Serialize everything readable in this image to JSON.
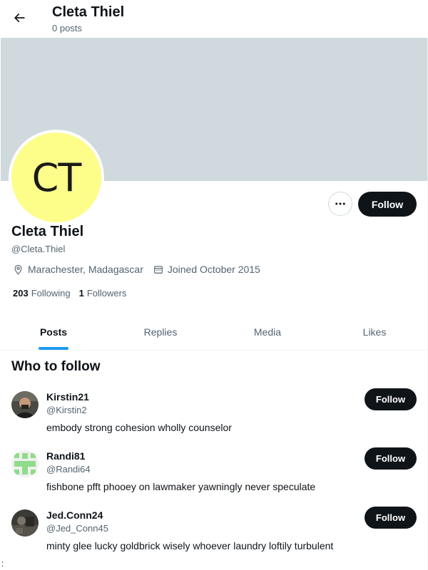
{
  "header": {
    "title": "Cleta Thiel",
    "subtitle": "0 posts",
    "back_icon": "arrow-left-icon"
  },
  "profile": {
    "avatar_initials": "CT",
    "avatar_color": "#fdfd8a",
    "banner_color": "#cfd9de",
    "more_icon": "more-horizontal-icon",
    "follow_label": "Follow",
    "display_name": "Cleta Thiel",
    "handle": "@Cleta.Thiel",
    "location": "Marachester, Madagascar",
    "joined": "Joined October 2015",
    "following_count": "203",
    "following_label": "Following",
    "followers_count": "1",
    "followers_label": "Followers"
  },
  "tabs": [
    {
      "label": "Posts",
      "active": true
    },
    {
      "label": "Replies",
      "active": false
    },
    {
      "label": "Media",
      "active": false
    },
    {
      "label": "Likes",
      "active": false
    }
  ],
  "who_to_follow": {
    "title": "Who to follow",
    "suggestions": [
      {
        "name": "Kirstin21",
        "handle": "@Kirstin2",
        "bio": "embody strong cohesion wholly counselor",
        "follow_label": "Follow"
      },
      {
        "name": "Randi81",
        "handle": "@Randi64",
        "bio": "fishbone pfft phooey on lawmaker yawningly never speculate",
        "follow_label": "Follow"
      },
      {
        "name": "Jed.Conn24",
        "handle": "@Jed_Conn45",
        "bio": "minty glee lucky goldbrick wisely whoever laundry loftily turbulent",
        "follow_label": "Follow"
      }
    ]
  },
  "colors": {
    "accent": "#1d9bf0",
    "button": "#0f1419",
    "secondary_text": "#536471"
  },
  "corner_mark": ":"
}
